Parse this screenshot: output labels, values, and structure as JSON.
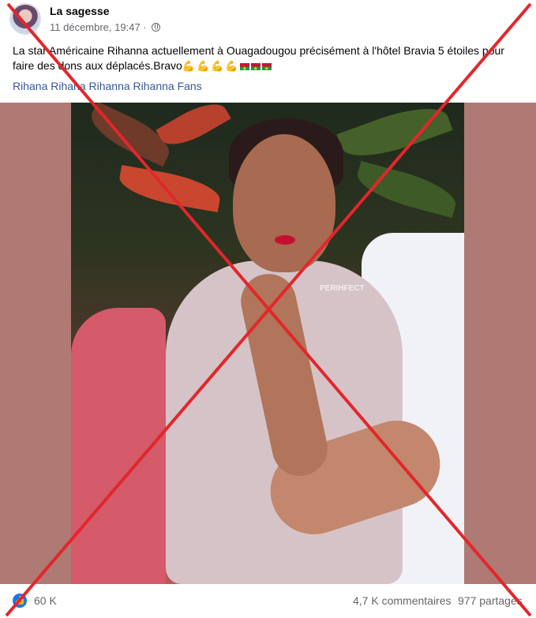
{
  "post": {
    "author": "La sagesse",
    "timestamp": "11 décembre, 19:47 ·",
    "text": "La star Américaine Rihanna actuellement à Ouagadougou  précisément à l'hôtel Bravia 5 étoiles pour faire des dons aux déplacés.Bravo",
    "tags": "Rihana Rihana Rihanna Rihanna Fans",
    "photo_watermark": "PERIHFECT"
  },
  "footer": {
    "reactions_count": "60 K",
    "comments_count": "4,7 K commentaires",
    "shares_count": "977 partages"
  },
  "colors": {
    "link": "#385898",
    "cross": "#e3262b",
    "photo_background": "#ae7a73",
    "reaction_blue": "#1877f2"
  },
  "icons": [
    "globe-icon",
    "like-icon",
    "flexed-biceps-emoji",
    "burkina-faso-flag-emoji"
  ]
}
